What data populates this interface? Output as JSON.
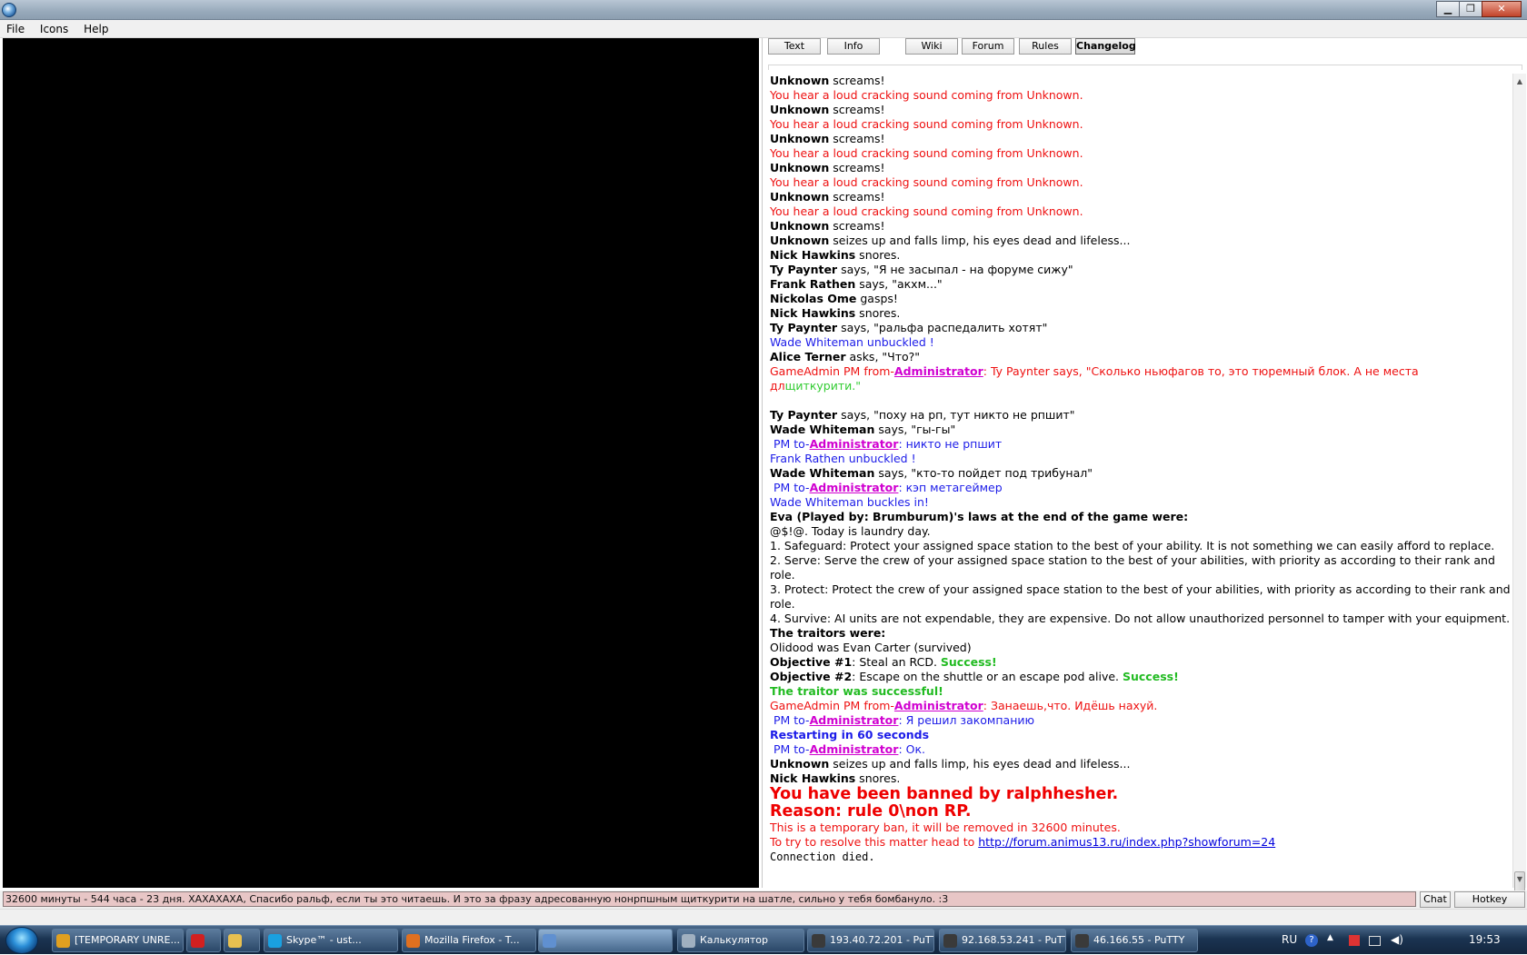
{
  "window": {
    "min": "▁",
    "max": "❐",
    "close": "✕"
  },
  "menu": [
    "File",
    "Icons",
    "Help"
  ],
  "tabs": [
    "Text",
    "Info",
    "Wiki",
    "Forum",
    "Rules",
    "Changelog"
  ],
  "active_tab": "Changelog",
  "log": [
    [
      {
        "t": "Unknown",
        "s": "name"
      },
      {
        "t": " screams!"
      }
    ],
    [
      {
        "t": "You hear a loud cracking sound coming from Unknown.",
        "s": "red"
      }
    ],
    [
      {
        "t": "Unknown",
        "s": "name"
      },
      {
        "t": " screams!"
      }
    ],
    [
      {
        "t": "You hear a loud cracking sound coming from Unknown.",
        "s": "red"
      }
    ],
    [
      {
        "t": "Unknown",
        "s": "name"
      },
      {
        "t": " screams!"
      }
    ],
    [
      {
        "t": "You hear a loud cracking sound coming from Unknown.",
        "s": "red"
      }
    ],
    [
      {
        "t": "Unknown",
        "s": "name"
      },
      {
        "t": " screams!"
      }
    ],
    [
      {
        "t": "You hear a loud cracking sound coming from Unknown.",
        "s": "red"
      }
    ],
    [
      {
        "t": "Unknown",
        "s": "name"
      },
      {
        "t": " screams!"
      }
    ],
    [
      {
        "t": "You hear a loud cracking sound coming from Unknown.",
        "s": "red"
      }
    ],
    [
      {
        "t": "Unknown",
        "s": "name"
      },
      {
        "t": " screams!"
      }
    ],
    [
      {
        "t": "Unknown",
        "s": "name"
      },
      {
        "t": " seizes up and falls limp, his eyes dead and lifeless..."
      }
    ],
    [
      {
        "t": "Nick Hawkins",
        "s": "name"
      },
      {
        "t": " snores."
      }
    ],
    [
      {
        "t": "Ty Paynter",
        "s": "name"
      },
      {
        "t": " says, \"Я не засыпал - на форуме сижу\""
      }
    ],
    [
      {
        "t": "Frank Rathen",
        "s": "name"
      },
      {
        "t": " says, \"акхм...\""
      }
    ],
    [
      {
        "t": "Nickolas Ome",
        "s": "name"
      },
      {
        "t": " gasps!"
      }
    ],
    [
      {
        "t": "Nick Hawkins",
        "s": "name"
      },
      {
        "t": " snores."
      }
    ],
    [
      {
        "t": "Ty Paynter",
        "s": "name"
      },
      {
        "t": " says, \"ральфа распедалить хотят\""
      }
    ],
    [
      {
        "t": "Wade Whiteman unbuckled !",
        "s": "blue"
      }
    ],
    [
      {
        "t": "Alice Terner",
        "s": "name"
      },
      {
        "t": " asks, \"Что?\""
      }
    ],
    [
      {
        "t": "GameAdmin PM from-",
        "s": "red"
      },
      {
        "t": "Administrator",
        "s": "magenta-link"
      },
      {
        "t": ": Ty Paynter says, \"Сколько ньюфагов то, это тюремный блок. А не места дл",
        "s": "red"
      },
      {
        "t": "щиткурити.\"",
        "s": "green"
      }
    ],
    [
      {
        "t": " "
      }
    ],
    [
      {
        "t": "Ty Paynter",
        "s": "name"
      },
      {
        "t": " says, \"поху на рп, тут никто не рпшит\""
      }
    ],
    [
      {
        "t": "Wade Whiteman",
        "s": "name"
      },
      {
        "t": " says, \"гы-гы\""
      }
    ],
    [
      {
        "t": " PM to-",
        "s": "blue"
      },
      {
        "t": "Administrator",
        "s": "magenta-link"
      },
      {
        "t": ": никто не рпшит",
        "s": "blue"
      }
    ],
    [
      {
        "t": "Frank Rathen unbuckled !",
        "s": "blue"
      }
    ],
    [
      {
        "t": "Wade Whiteman",
        "s": "name"
      },
      {
        "t": " says, \"кто-то пойдет под трибунал\""
      }
    ],
    [
      {
        "t": " PM to-",
        "s": "blue"
      },
      {
        "t": "Administrator",
        "s": "magenta-link"
      },
      {
        "t": ": кэп метагеймер",
        "s": "blue"
      }
    ],
    [
      {
        "t": "Wade Whiteman buckles in!",
        "s": "blue"
      }
    ],
    [
      {
        "t": "Eva (Played by: Brumburum)'s laws at the end of the game were:",
        "s": "name"
      }
    ],
    [
      {
        "t": "@$!@. Today is laundry day."
      }
    ],
    [
      {
        "t": "1. Safeguard: Protect your assigned space station to the best of your ability. It is not something we can easily afford to replace."
      }
    ],
    [
      {
        "t": "2. Serve: Serve the crew of your assigned space station to the best of your abilities, with priority as according to their rank and role."
      }
    ],
    [
      {
        "t": "3. Protect: Protect the crew of your assigned space station to the best of your abilities, with priority as according to their rank and role."
      }
    ],
    [
      {
        "t": "4. Survive: AI units are not expendable, they are expensive. Do not allow unauthorized personnel to tamper with your equipment."
      }
    ],
    [
      {
        "t": "The traitors were:",
        "s": "name"
      }
    ],
    [
      {
        "t": "Olidood was Evan Carter (survived)"
      }
    ],
    [
      {
        "t": "Objective #1",
        "s": "name"
      },
      {
        "t": ": Steal an RCD. "
      },
      {
        "t": "Success!",
        "s": "green-b"
      }
    ],
    [
      {
        "t": "Objective #2",
        "s": "name"
      },
      {
        "t": ": Escape on the shuttle or an escape pod alive. "
      },
      {
        "t": "Success!",
        "s": "green-b"
      }
    ],
    [
      {
        "t": "The traitor was successful!",
        "s": "green-b"
      }
    ],
    [
      {
        "t": "GameAdmin PM from-",
        "s": "red"
      },
      {
        "t": "Administrator",
        "s": "magenta-link"
      },
      {
        "t": ": Занаешь,что. Идёшь нахуй.",
        "s": "red"
      }
    ],
    [
      {
        "t": " PM to-",
        "s": "blue"
      },
      {
        "t": "Administrator",
        "s": "magenta-link"
      },
      {
        "t": ": Я решил закомпанию",
        "s": "blue"
      }
    ],
    [
      {
        "t": "Restarting in 60 seconds",
        "s": "blue-bold"
      }
    ],
    [
      {
        "t": " PM to-",
        "s": "blue"
      },
      {
        "t": "Administrator",
        "s": "magenta-link"
      },
      {
        "t": ": Ок.",
        "s": "blue"
      }
    ],
    [
      {
        "t": "Unknown",
        "s": "name"
      },
      {
        "t": " seizes up and falls limp, his eyes dead and lifeless..."
      }
    ],
    [
      {
        "t": "Nick Hawkins",
        "s": "name"
      },
      {
        "t": " snores."
      }
    ],
    [
      {
        "t": "You have been banned by ralphhesher.",
        "s": "big-red"
      }
    ],
    [
      {
        "t": "Reason: rule 0\\non RP.",
        "s": "big-red"
      }
    ],
    [
      {
        "t": "This is a temporary ban, it will be removed in 32600 minutes.",
        "s": "red"
      }
    ],
    [
      {
        "t": "To try to resolve this matter head to ",
        "s": "red"
      },
      {
        "t": "http://forum.animus13.ru/index.php?showforum=24",
        "s": "link-blue"
      }
    ],
    [
      {
        "t": "Connection died.",
        "s": "mono"
      }
    ]
  ],
  "input": {
    "value": "32600 минуты - 544 часа - 23 дня. ХАХАХАХА, Спасибо ральф, если ты это читаешь. И это за фразу адресованную нонрпшным щиткурити на шатле, сильно у тебя бомбануло. :3"
  },
  "buttons": {
    "chat": "Chat",
    "hotkey": "Hotkey Toggle"
  },
  "taskbar": {
    "items": [
      {
        "label": "[TEMPORARY UNRE...",
        "color": "#e0a020"
      },
      {
        "label": "",
        "color": "#d22020"
      },
      {
        "label": "",
        "color": "#e8c050"
      },
      {
        "label": "Skype™ - ust...",
        "color": "#1aa0e0"
      },
      {
        "label": "Mozilla Firefox - T...",
        "color": "#e07020"
      },
      {
        "label": "",
        "color": "#6090d0"
      },
      {
        "label": "Калькулятор",
        "color": "#a0b0c0"
      },
      {
        "label": "193.40.72.201 - PuTTY",
        "color": "#3a3a3a"
      },
      {
        "label": "92.168.53.241 - PuTTY",
        "color": "#3a3a3a"
      },
      {
        "label": "46.166.55 - PuTTY",
        "color": "#3a3a3a"
      }
    ],
    "lang": "RU",
    "clock": "19:53",
    "help": "?"
  }
}
